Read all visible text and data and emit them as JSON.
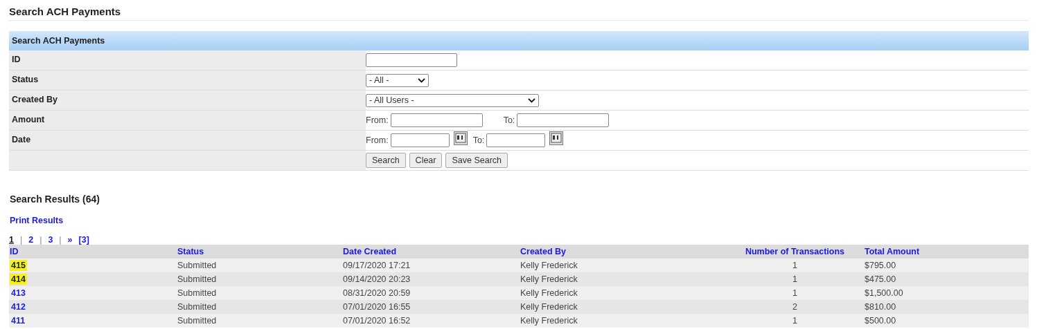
{
  "page_title": "Search ACH Payments",
  "search_form": {
    "title": "Search ACH Payments",
    "rows": [
      {
        "kind": "text",
        "label": "ID"
      },
      {
        "kind": "select",
        "label": "Status",
        "value": "- All -"
      },
      {
        "kind": "wide-select",
        "label": "Created By",
        "value": "- All Users -"
      },
      {
        "kind": "range",
        "label": "Amount",
        "from_label": "From:",
        "to_label": "To:"
      },
      {
        "kind": "daterange",
        "label": "Date",
        "from_label": "From:",
        "to_label": "To:"
      },
      {
        "kind": "buttons",
        "buttons": [
          "Search",
          "Clear",
          "Save Search"
        ]
      }
    ]
  },
  "results": {
    "title": "Search Results (64)",
    "print_link": "Print Results",
    "pagination": [
      {
        "kind": "link",
        "label": "1",
        "selected": true
      },
      {
        "kind": "separator",
        "label": "|"
      },
      {
        "kind": "link",
        "label": "2",
        "selected": false
      },
      {
        "kind": "separator",
        "label": "|"
      },
      {
        "kind": "link",
        "label": "3",
        "selected": false
      },
      {
        "kind": "separator",
        "label": "|"
      },
      {
        "kind": "link",
        "label": "»",
        "selected": false
      },
      {
        "kind": "link",
        "label": "[3]",
        "selected": false
      }
    ],
    "columns": [
      "ID",
      "Status",
      "Date Created",
      "Created By",
      "Number of Transactions",
      "Total Amount"
    ],
    "rows": [
      {
        "id": "415",
        "highlighted": true,
        "status": "Submitted",
        "date": "09/17/2020 17:21",
        "created_by": "Kelly Frederick",
        "transactions": "1",
        "amount": "$795.00"
      },
      {
        "id": "414",
        "highlighted": true,
        "status": "Submitted",
        "date": "09/14/2020 20:23",
        "created_by": "Kelly Frederick",
        "transactions": "1",
        "amount": "$475.00"
      },
      {
        "id": "413",
        "highlighted": false,
        "status": "Submitted",
        "date": "08/31/2020 20:59",
        "created_by": "Kelly Frederick",
        "transactions": "1",
        "amount": "$1,500.00"
      },
      {
        "id": "412",
        "highlighted": false,
        "status": "Submitted",
        "date": "07/01/2020 16:55",
        "created_by": "Kelly Frederick",
        "transactions": "2",
        "amount": "$810.00"
      },
      {
        "id": "411",
        "highlighted": false,
        "status": "Submitted",
        "date": "07/01/2020 16:52",
        "created_by": "Kelly Frederick",
        "transactions": "1",
        "amount": "$500.00"
      }
    ]
  }
}
